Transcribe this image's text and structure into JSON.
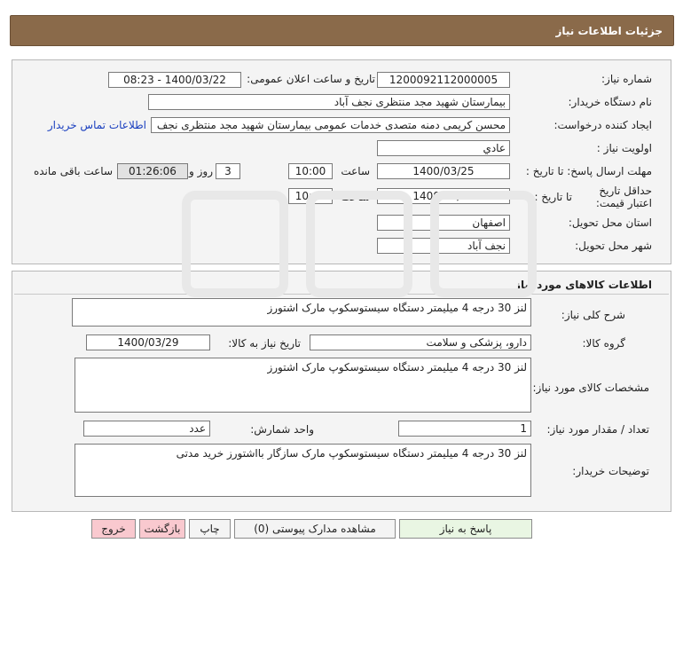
{
  "header": {
    "title": "جزئیات اطلاعات نیاز"
  },
  "labels": {
    "need_number": "شماره نیاز:",
    "announce_datetime": "تاریخ و ساعت اعلان عمومی:",
    "buyer_org": "نام دستگاه خریدار:",
    "requester": "ایجاد کننده درخواست:",
    "priority": "اولویت نیاز :",
    "deadline_send": "مهلت ارسال پاسخ: تا تاریخ :",
    "time": "ساعت",
    "days_and": "روز و",
    "hours_left": "ساعت باقی مانده",
    "price_validity": "حداقل تاریخ اعتبار قیمت:",
    "until_date": "تا تاریخ :",
    "time2": "ساعت",
    "province": "استان محل تحویل:",
    "city": "شهر محل تحویل:"
  },
  "values": {
    "need_number": "1200092112000005",
    "announce_datetime": "1400/03/22 - 08:23",
    "buyer_org": "بیمارستان شهید مجد منتظری نجف آباد",
    "requester": "محسن کریمی دمنه متصدی خدمات عمومی بیمارستان شهید مجد منتظری نجف",
    "contact_link": "اطلاعات تماس خریدار",
    "priority": "عادي",
    "deadline_date": "1400/03/25",
    "deadline_time": "10:00",
    "days_left": "3",
    "time_left": "01:26:06",
    "validity_date": "1400/03/27",
    "validity_time": "10:00",
    "province": "اصفهان",
    "city": "نجف آباد"
  },
  "goods": {
    "section_title": "اطلاعات کالاهای مورد نیاز",
    "general_desc_label": "شرح کلی نیاز:",
    "general_desc": "لنز 30 درجه 4 میلیمتر دستگاه سیستوسکوپ مارک اشتورز",
    "group_label": "گروه کالا:",
    "group": "دارو، پزشکی و سلامت",
    "need_date_label": "تاریخ نیاز به کالا:",
    "need_date": "1400/03/29",
    "spec_label": "مشخصات کالای مورد نیاز:",
    "spec": "لنز 30 درجه 4 میلیمتر دستگاه سیستوسکوپ مارک اشتورز",
    "qty_label": "تعداد / مقدار مورد نیاز:",
    "qty": "1",
    "unit_label": "واحد شمارش:",
    "unit": "عدد",
    "buyer_notes_label": "توضیحات خریدار:",
    "buyer_notes": "لنز 30 درجه 4 میلیمتر دستگاه سیستوسکوپ مارک سازگار بااشتورز خرید مدتی"
  },
  "buttons": {
    "reply": "پاسخ به نیاز",
    "attachments": "مشاهده مدارک پیوستی (0)",
    "print": "چاپ",
    "back": "بازگشت",
    "exit": "خروج"
  },
  "colors": {
    "header_bg": "#8a6a4a",
    "panel_bg": "#f4f4f4",
    "link": "#1a3fbf",
    "reply_btn": "#e9f6e3",
    "exit_btn": "#f9c9cf"
  }
}
